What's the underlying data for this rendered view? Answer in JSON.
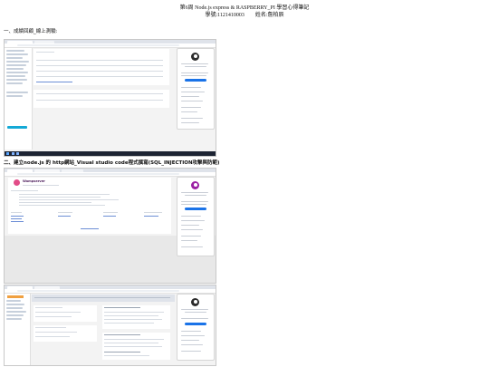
{
  "document": {
    "title_line1": "第6周 Node.js express & RASPBERRY_PI 學習心得筆記",
    "title_line2": "學號:1121410003　　姓名:詹柏辰"
  },
  "sections": [
    {
      "heading": "一、成績回顧_線上測驗:"
    },
    {
      "heading": "二、建立node.js 的 http網站_Visual studio code程式撰寫(SQL_INJECTION攻擊與防範)"
    }
  ],
  "screenshots": [
    {
      "name": "online-exam-results-screenshot"
    },
    {
      "name": "wampserver-localhost-screenshot",
      "app": "Wampserver"
    },
    {
      "name": "phpmyadmin-screenshot"
    }
  ]
}
